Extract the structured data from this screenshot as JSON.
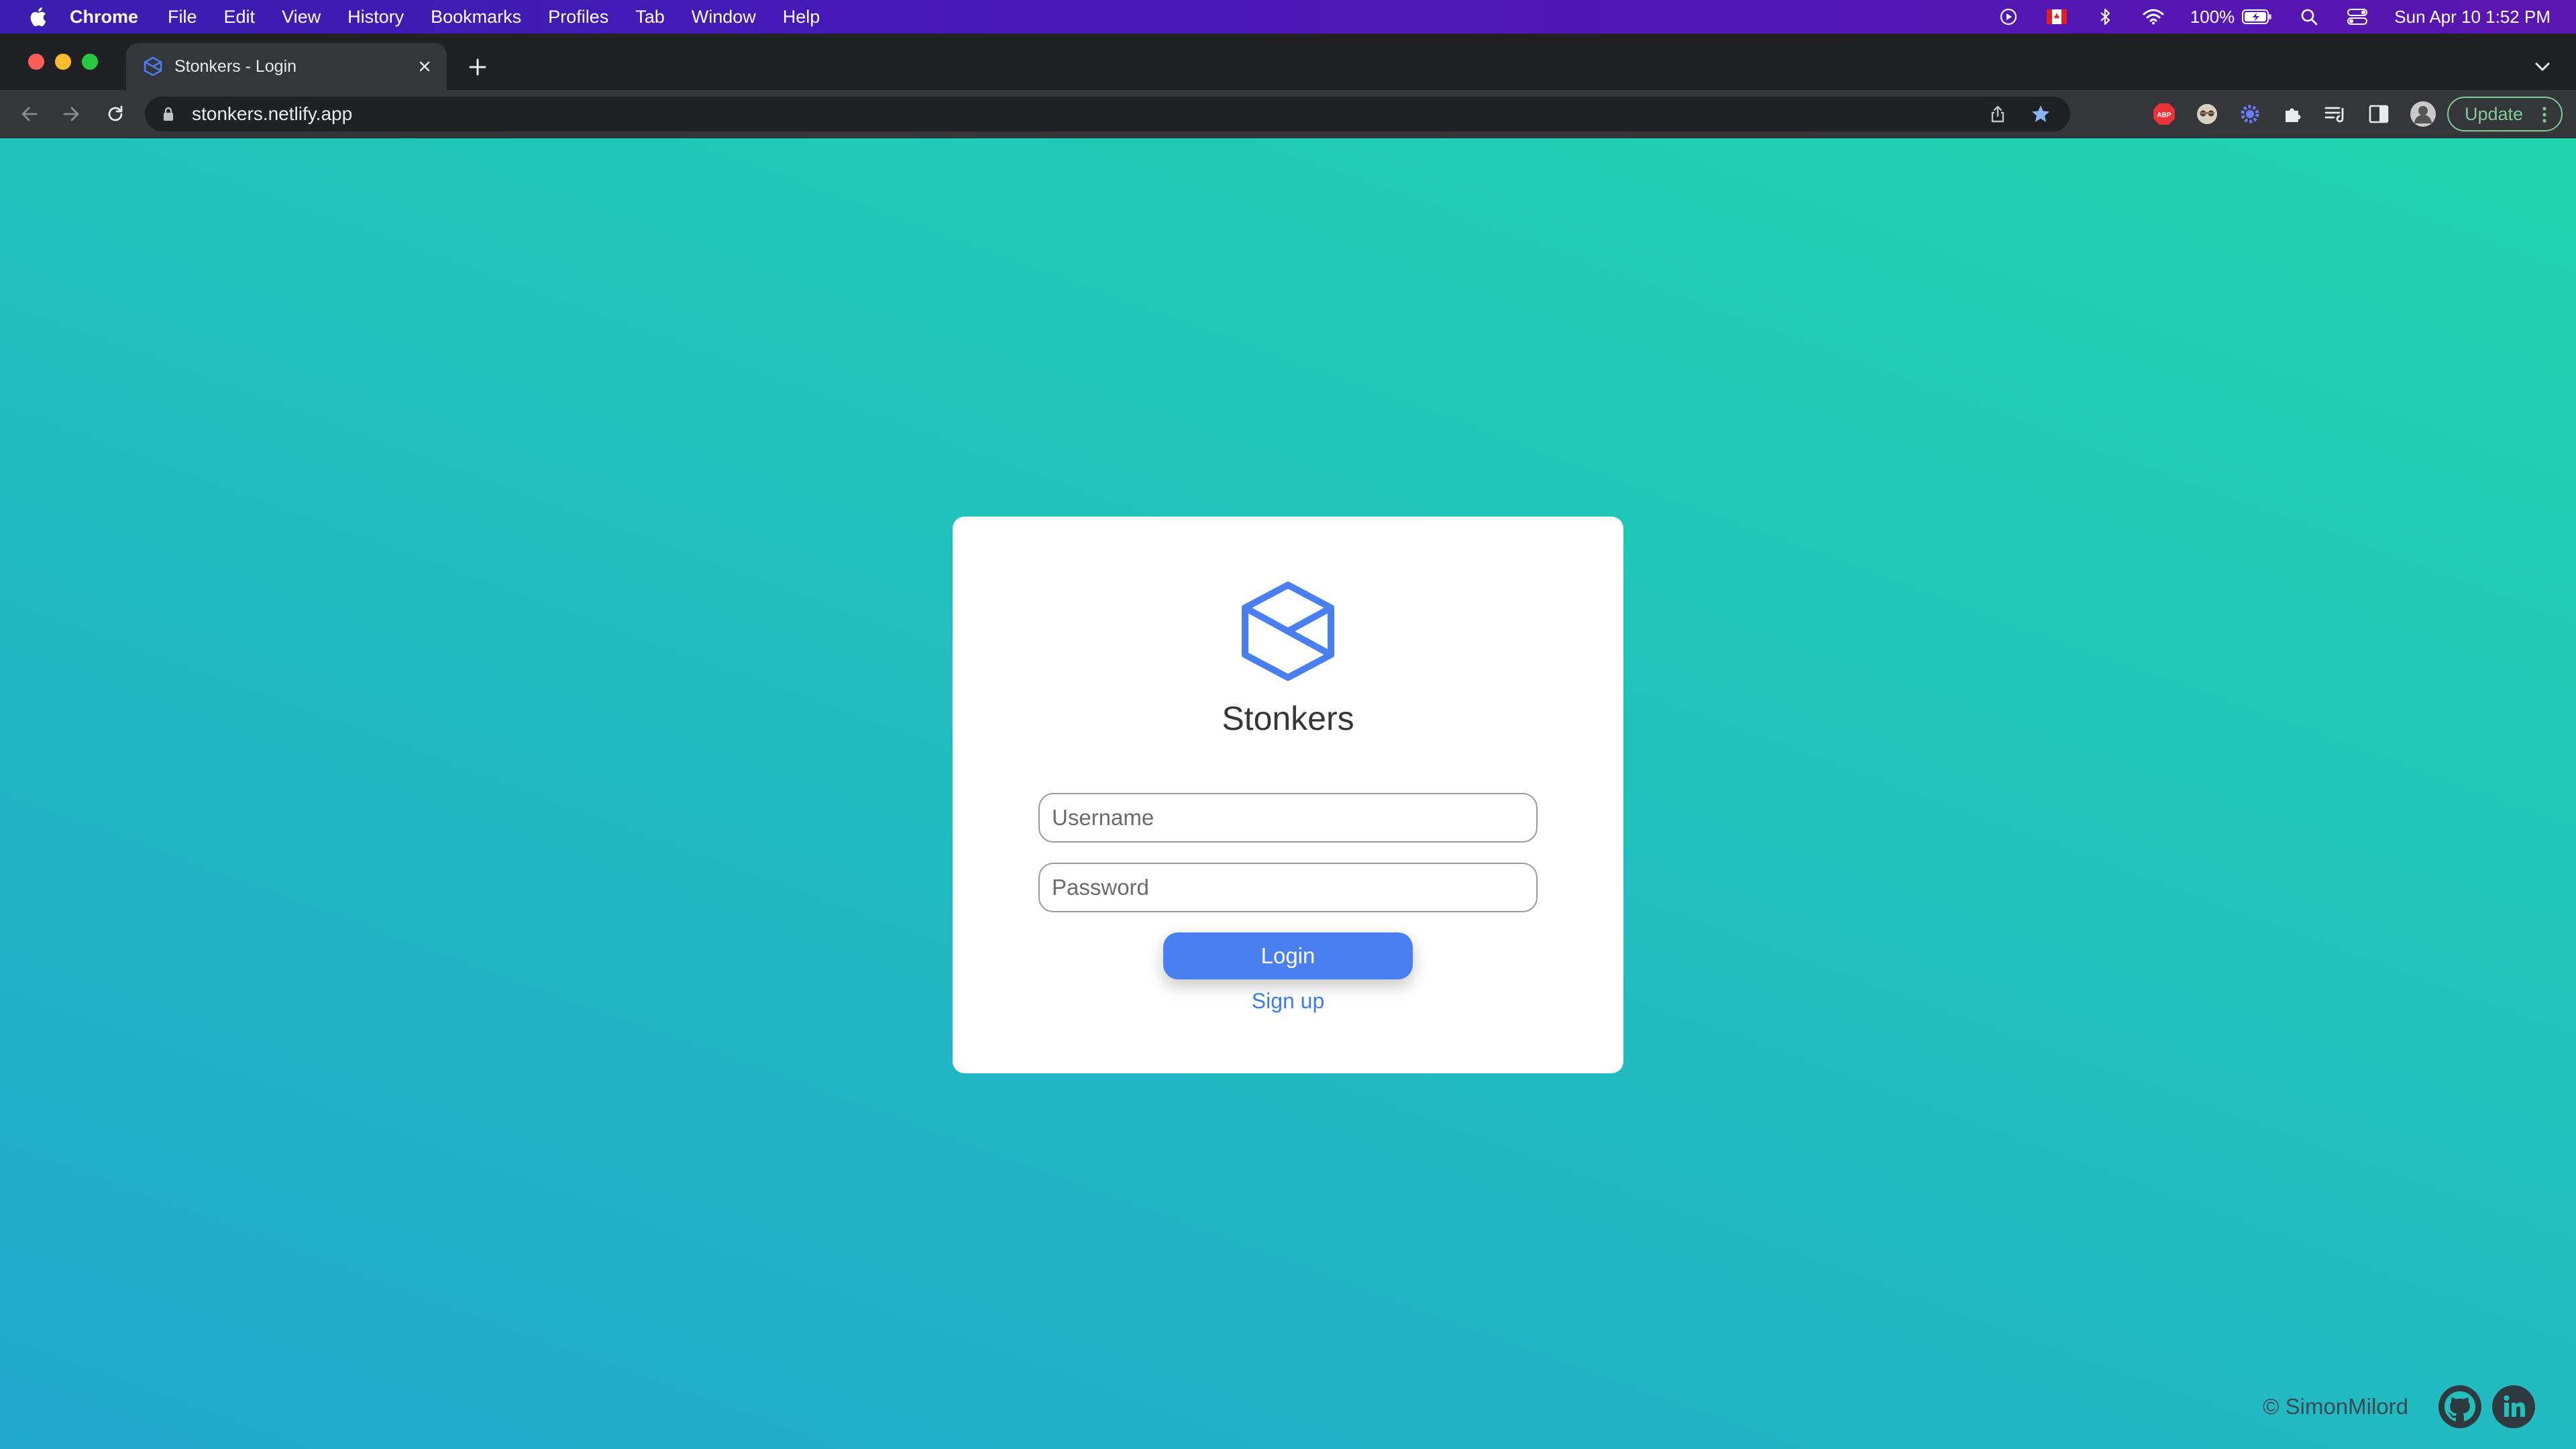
{
  "menubar": {
    "app_name": "Chrome",
    "items": [
      "File",
      "Edit",
      "View",
      "History",
      "Bookmarks",
      "Profiles",
      "Tab",
      "Window",
      "Help"
    ],
    "battery": "100%",
    "datetime": "Sun Apr 10  1:52 PM"
  },
  "browser": {
    "tab_title": "Stonkers - Login",
    "url": "stonkers.netlify.app",
    "update_label": "Update",
    "abp_label": "ABP"
  },
  "page": {
    "brand": "Stonkers",
    "username_placeholder": "Username",
    "password_placeholder": "Password",
    "login_label": "Login",
    "signup_label": "Sign up",
    "footer_text": "© SimonMilord",
    "colors": {
      "accent": "#4a7ff2",
      "link": "#3f7de6",
      "gradient_start": "#21a7cd",
      "gradient_end": "#23d4ae"
    }
  },
  "icons": {
    "logo": "cube-icon",
    "social": [
      "github-icon",
      "linkedin-icon"
    ]
  }
}
